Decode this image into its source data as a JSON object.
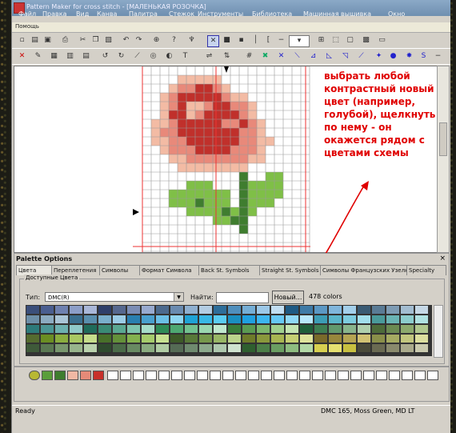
{
  "titlebar": {
    "title": "Pattern Maker for cross stitch - [МАЛЕНЬКАЯ РОЗОЧКА]"
  },
  "menu": [
    "Файл",
    "Правка",
    "Вид",
    "Канва",
    "Палитра",
    "Стежок",
    "Инструменты",
    "Библиотека",
    "Машинная вышивка",
    "Окно"
  ],
  "helpbar": {
    "label": "Помощь"
  },
  "annotation": "выбрать любой контрастный новый цвет (например, голубой), щелкнуть по нему - он окажется рядом с цветами схемы",
  "palette": {
    "title": "Palette Options",
    "close": "×",
    "tabs": [
      "Цвета",
      "Переплетения",
      "Символы",
      "Формат Символа",
      "Back St. Symbols",
      "Straight St. Symbols",
      "Символы Французских Узелков",
      "Specialty"
    ],
    "group_label": "Доступные Цвета",
    "type_label": "Тип:",
    "type_value": "DMC(R)",
    "find_label": "Найти:",
    "new_button": "Новый...",
    "color_count": "478 colors"
  },
  "colors": {
    "pink_light": "#f3bba4",
    "pink_mid": "#e8897a",
    "red": "#c0302b",
    "green_light": "#7fbf47",
    "green_dark": "#3f7d2f",
    "annotation_red": "#e00000"
  },
  "status": {
    "left": "Ready",
    "right": "DMC 165, Moss Green, MD LT"
  }
}
